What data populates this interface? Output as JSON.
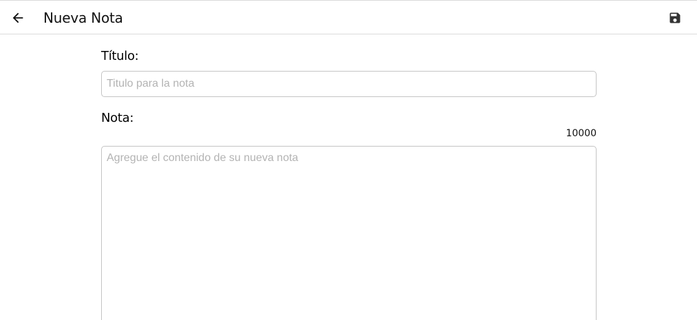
{
  "appbar": {
    "title": "Nueva Nota",
    "back_icon": "arrow-left-icon",
    "save_icon": "save-icon"
  },
  "form": {
    "title_label": "Título:",
    "title_placeholder": "Titulo para la nota",
    "title_value": "",
    "note_label": "Nota:",
    "char_counter": "10000",
    "note_placeholder": "Agregue el contenido de su nueva nota",
    "note_value": ""
  },
  "colors": {
    "border": "#c4c4c4",
    "placeholder": "#b3b3b3",
    "icon": "#222222"
  }
}
